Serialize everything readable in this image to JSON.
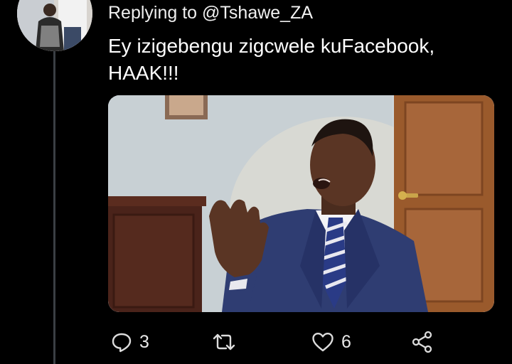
{
  "reply_context": {
    "prefix": "Replying to ",
    "handle": "@Tshawe_ZA"
  },
  "tweet": {
    "text_line1": "Ey izigebengu zigcwele kuFacebook,",
    "text_line2": "HAAK!!!"
  },
  "actions": {
    "reply": {
      "icon": "reply-icon",
      "count": "3"
    },
    "retweet": {
      "icon": "retweet-icon",
      "count": ""
    },
    "like": {
      "icon": "heart-icon",
      "count": "6"
    },
    "share": {
      "icon": "share-icon"
    }
  },
  "colors": {
    "background": "#000000",
    "text": "#ffffff",
    "thread_line": "#3a3f44",
    "icon": "#dcdcdc"
  }
}
